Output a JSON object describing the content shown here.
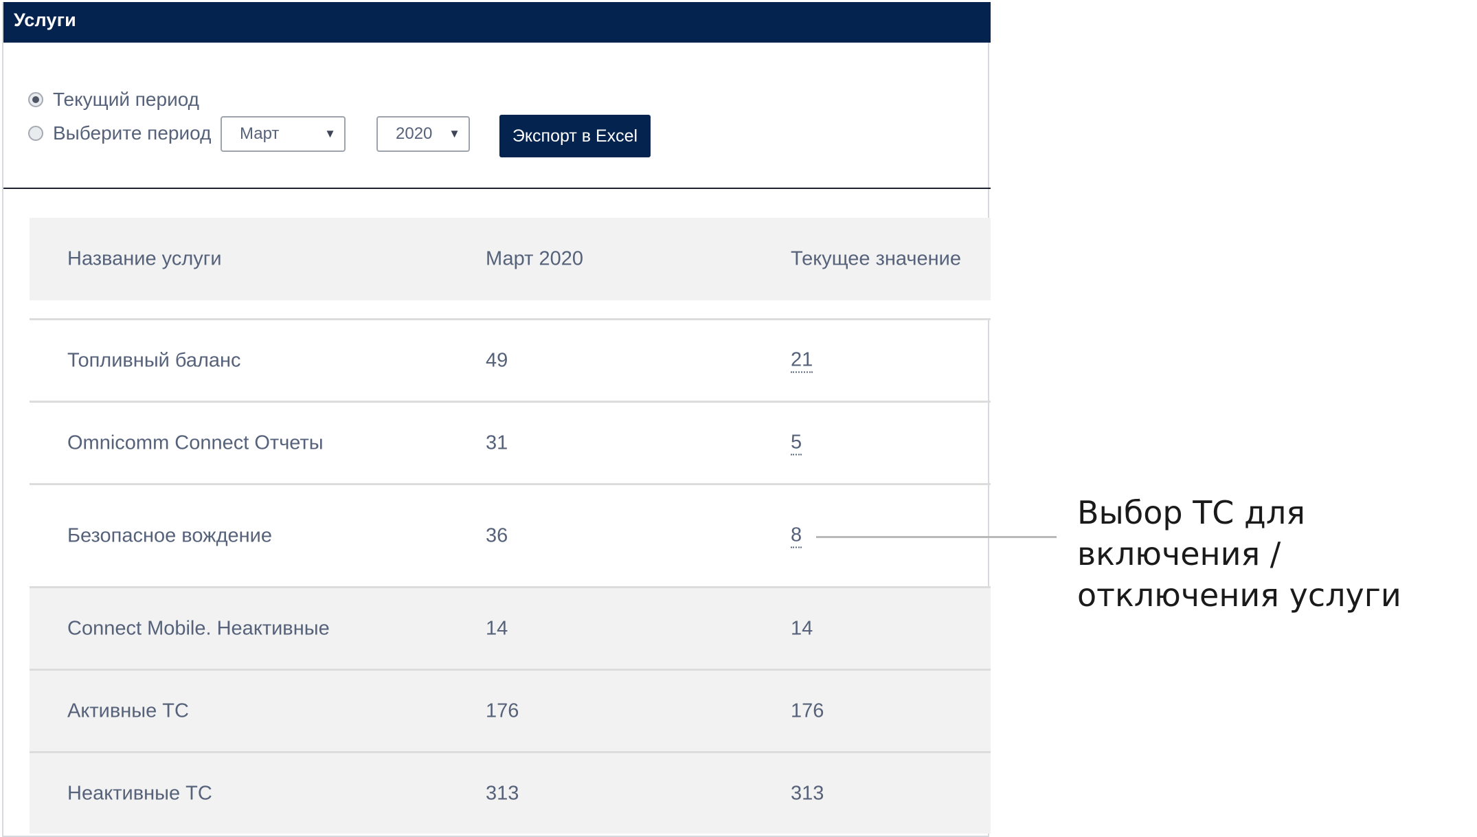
{
  "header": {
    "title": "Услуги"
  },
  "period": {
    "current_label": "Текущий период",
    "select_label": "Выберите период",
    "current_selected": true,
    "month_value": "Март",
    "year_value": "2020",
    "caret_glyph": "▼"
  },
  "toolbar": {
    "export_label": "Экспорт в Excel"
  },
  "table": {
    "headers": [
      "Название услуги",
      "Март 2020",
      "Текущее значение"
    ],
    "rows": [
      {
        "name": "Топливный баланс",
        "march": "49",
        "current": "21",
        "current_is_link": true
      },
      {
        "name": "Omnicomm Connect Отчеты",
        "march": "31",
        "current": "5",
        "current_is_link": true
      },
      {
        "name": "Безопасное вождение",
        "march": "36",
        "current": "8",
        "current_is_link": true
      },
      {
        "name": "Connect Mobile. Неактивные",
        "march": "14",
        "current": "14",
        "current_is_link": false
      },
      {
        "name": "Активные ТС",
        "march": "176",
        "current": "176",
        "current_is_link": false
      },
      {
        "name": "Неактивные ТС",
        "march": "313",
        "current": "313",
        "current_is_link": false
      }
    ]
  },
  "callout": {
    "line1": "Выбор ТС для включения /",
    "line2": "отключения услуги"
  },
  "colors": {
    "header_bg": "#04234f",
    "text": "#56627a",
    "row_shade": "#f2f2f2"
  }
}
